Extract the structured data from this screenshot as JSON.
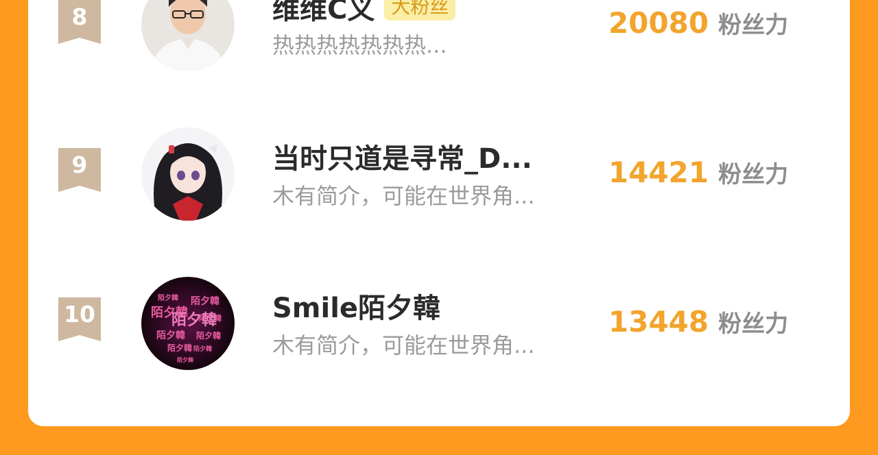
{
  "colors": {
    "background": "#fe9a1f",
    "card": "#ffffff",
    "rank_badge": "#cfb8a0",
    "score": "#f2a42c",
    "name": "#2b2b2b",
    "bio": "#9b9b9b",
    "unit": "#8d8d8d",
    "tag_bg": "#fbeea6",
    "tag_text": "#d79a1a"
  },
  "leaderboard": {
    "rows": [
      {
        "rank": "8",
        "name": "维维C义",
        "tag": "大粉丝",
        "bio": "热热热热热热热...",
        "score": "20080",
        "unit": "粉丝力",
        "avatar_icon": "man-photo-avatar-icon"
      },
      {
        "rank": "9",
        "name": "当时只道是寻常_D...",
        "tag": "",
        "bio": "木有简介，可能在世界角...",
        "score": "14421",
        "unit": "粉丝力",
        "avatar_icon": "anime-girl-avatar-icon"
      },
      {
        "rank": "10",
        "name": "Smile陌夕韓",
        "tag": "",
        "bio": "木有简介，可能在世界角...",
        "score": "13448",
        "unit": "粉丝力",
        "avatar_icon": "pink-text-avatar-icon"
      }
    ]
  }
}
